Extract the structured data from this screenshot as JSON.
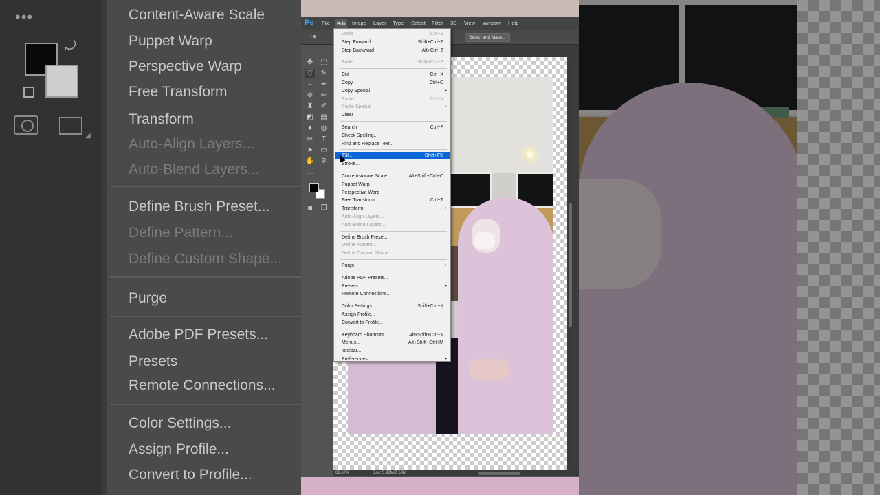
{
  "app": {
    "logo": "Ps"
  },
  "menubar": {
    "items": [
      "File",
      "Edit",
      "Image",
      "Layer",
      "Type",
      "Select",
      "Filter",
      "3D",
      "View",
      "Window",
      "Help"
    ],
    "active": "Edit"
  },
  "options": {
    "select_and_mask": "Select and Mask..."
  },
  "status": {
    "zoom": "66.67%",
    "doc": "Doc: 5.93M/7.50M"
  },
  "edit_menu": {
    "highlighted": "Fill...",
    "items": [
      {
        "label": "Undo",
        "shortcut": "Ctrl+Z",
        "disabled": true
      },
      {
        "label": "Step Forward",
        "shortcut": "Shift+Ctrl+Z"
      },
      {
        "label": "Step Backward",
        "shortcut": "Alt+Ctrl+Z"
      },
      {
        "separator": true
      },
      {
        "label": "Fade...",
        "shortcut": "Shift+Ctrl+F",
        "disabled": true
      },
      {
        "separator": true
      },
      {
        "label": "Cut",
        "shortcut": "Ctrl+X"
      },
      {
        "label": "Copy",
        "shortcut": "Ctrl+C"
      },
      {
        "label": "Copy Special",
        "submenu": true
      },
      {
        "label": "Paste",
        "shortcut": "Ctrl+V",
        "disabled": true
      },
      {
        "label": "Paste Special",
        "submenu": true,
        "disabled": true
      },
      {
        "label": "Clear"
      },
      {
        "separator": true
      },
      {
        "label": "Search",
        "shortcut": "Ctrl+F"
      },
      {
        "label": "Check Spelling..."
      },
      {
        "label": "Find and Replace Text..."
      },
      {
        "separator": true
      },
      {
        "label": "Fill...",
        "shortcut": "Shift+F5"
      },
      {
        "label": "Stroke..."
      },
      {
        "separator": true
      },
      {
        "label": "Content-Aware Scale",
        "shortcut": "Alt+Shift+Ctrl+C"
      },
      {
        "label": "Puppet Warp"
      },
      {
        "label": "Perspective Warp"
      },
      {
        "label": "Free Transform",
        "shortcut": "Ctrl+T"
      },
      {
        "label": "Transform",
        "submenu": true
      },
      {
        "label": "Auto-Align Layers...",
        "disabled": true
      },
      {
        "label": "Auto-Blend Layers...",
        "disabled": true
      },
      {
        "separator": true
      },
      {
        "label": "Define Brush Preset..."
      },
      {
        "label": "Define Pattern...",
        "disabled": true
      },
      {
        "label": "Define Custom Shape...",
        "disabled": true
      },
      {
        "separator": true
      },
      {
        "label": "Purge",
        "submenu": true
      },
      {
        "separator": true
      },
      {
        "label": "Adobe PDF Presets..."
      },
      {
        "label": "Presets",
        "submenu": true
      },
      {
        "label": "Remote Connections..."
      },
      {
        "separator": true
      },
      {
        "label": "Color Settings...",
        "shortcut": "Shift+Ctrl+K"
      },
      {
        "label": "Assign Profile..."
      },
      {
        "label": "Convert to Profile..."
      },
      {
        "separator": true
      },
      {
        "label": "Keyboard Shortcuts...",
        "shortcut": "Alt+Shift+Ctrl+K"
      },
      {
        "label": "Menus...",
        "shortcut": "Alt+Shift+Ctrl+M"
      },
      {
        "label": "Toolbar..."
      },
      {
        "label": "Preferences",
        "submenu": true
      }
    ]
  },
  "zoomed_menu": {
    "items": [
      {
        "label": "Content-Aware Scale"
      },
      {
        "label": "Puppet Warp"
      },
      {
        "label": "Perspective Warp"
      },
      {
        "label": "Free Transform"
      },
      {
        "label": "Transform"
      },
      {
        "label": "Auto-Align Layers...",
        "disabled": true
      },
      {
        "label": "Auto-Blend Layers...",
        "disabled": true
      },
      {
        "label": "Define Brush Preset..."
      },
      {
        "label": "Define Pattern...",
        "disabled": true
      },
      {
        "label": "Define Custom Shape...",
        "disabled": true
      },
      {
        "label": "Purge"
      },
      {
        "label": "Adobe PDF Presets..."
      },
      {
        "label": "Presets"
      },
      {
        "label": "Remote Connections..."
      },
      {
        "label": "Color Settings..."
      },
      {
        "label": "Assign Profile..."
      },
      {
        "label": "Convert to Profile..."
      }
    ]
  },
  "colors": {
    "highlight": "#0a66d6",
    "menu_bg": "#f0f0f0",
    "ps_blue": "#4da3e6"
  }
}
